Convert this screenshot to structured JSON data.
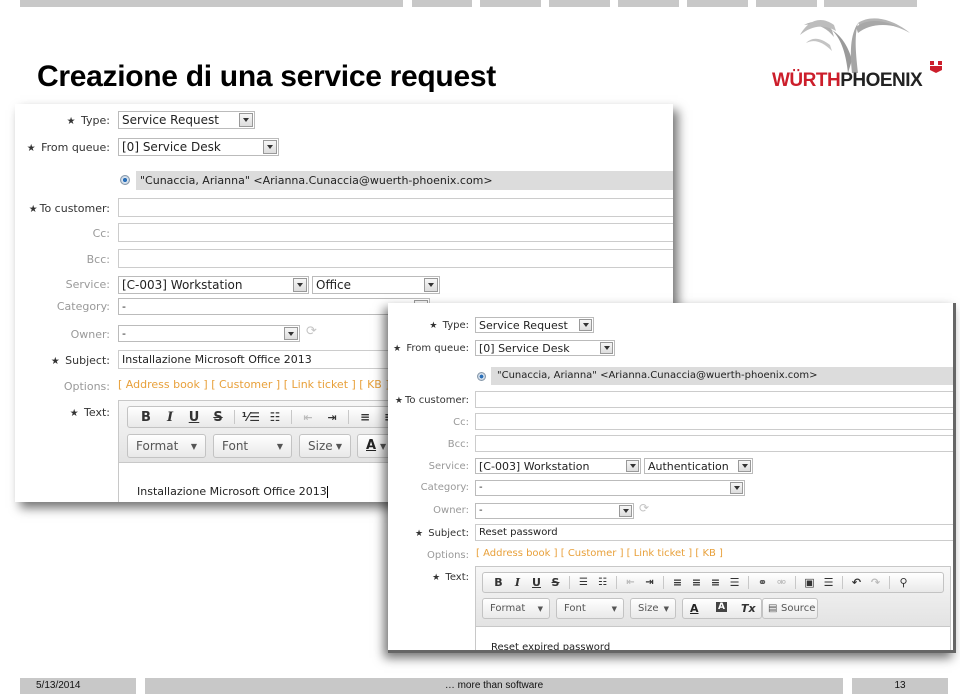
{
  "slide": {
    "title": "Creazione di una service request",
    "logo": {
      "left": "WÜRTH",
      "right": "PHOENIX",
      "brand_red": "#cc1e2b",
      "brand_dark": "#222222"
    },
    "footer": {
      "date": "5/13/2014",
      "tagline": "… more than software",
      "page": "13"
    }
  },
  "colors": {
    "option_link": "#e8a03a",
    "label_muted": "#999999",
    "bar_gray": "#c8c8c8",
    "selected_address_bg": "#dcdcdc"
  },
  "form1": {
    "labels": {
      "type": "Type:",
      "from_queue": "From queue:",
      "to_customer": "To customer:",
      "cc": "Cc:",
      "bcc": "Bcc:",
      "service": "Service:",
      "category": "Category:",
      "owner": "Owner:",
      "subject": "Subject:",
      "options": "Options:",
      "text": "Text:"
    },
    "required_marker": "★",
    "type_value": "Service Request",
    "from_queue_value": "[0] Service Desk",
    "selected_address": "\"Cunaccia, Arianna\" <Arianna.Cunaccia@wuerth-phoenix.com>",
    "to_customer_value": "",
    "cc_value": "",
    "bcc_value": "",
    "service_value": "[C-003] Workstation",
    "subservice_value": "Office",
    "category_value": "-",
    "owner_value": "-",
    "subject_value": "Installazione Microsoft Office 2013",
    "options": [
      "[ Address book ]",
      "[ Customer ]",
      "[ Link ticket ]",
      "[ KB ]"
    ],
    "editor": {
      "format_buttons": [
        "B",
        "I",
        "U",
        "S"
      ],
      "combos": [
        "Format",
        "Font",
        "Size"
      ],
      "text_color": "A",
      "body": "Installazione Microsoft Office 2013"
    }
  },
  "form2": {
    "labels": {
      "type": "Type:",
      "from_queue": "From queue:",
      "to_customer": "To customer:",
      "cc": "Cc:",
      "bcc": "Bcc:",
      "service": "Service:",
      "category": "Category:",
      "owner": "Owner:",
      "subject": "Subject:",
      "options": "Options:",
      "text": "Text:"
    },
    "required_marker": "★",
    "type_value": "Service Request",
    "from_queue_value": "[0] Service Desk",
    "selected_address": "\"Cunaccia, Arianna\" <Arianna.Cunaccia@wuerth-phoenix.com>",
    "to_customer_value": "",
    "cc_value": "",
    "bcc_value": "",
    "service_value": "[C-003] Workstation",
    "subservice_value": "Authentication",
    "category_value": "-",
    "owner_value": "-",
    "subject_value": "Reset password",
    "options": [
      "[ Address book ]",
      "[ Customer ]",
      "[ Link ticket ]",
      "[ KB ]"
    ],
    "editor": {
      "format_buttons": [
        "B",
        "I",
        "U",
        "S"
      ],
      "combos": [
        "Format",
        "Font",
        "Size"
      ],
      "text_color": "A",
      "bg_color": "A",
      "clear_format": "Tx",
      "source_label": "Source",
      "body": "Reset expired password"
    }
  }
}
